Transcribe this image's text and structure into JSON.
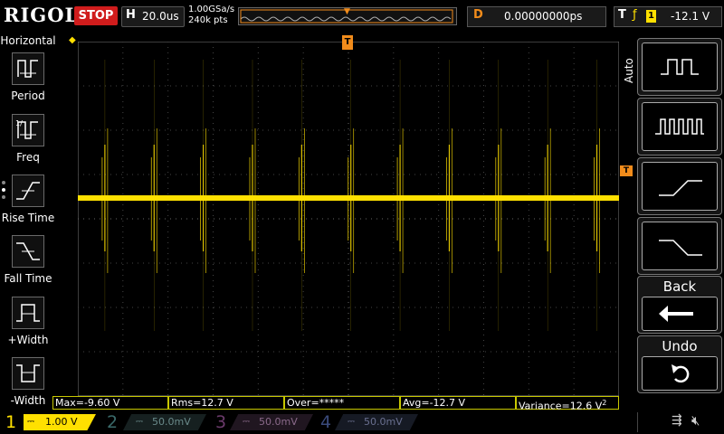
{
  "header": {
    "logo": "RIGOL",
    "run_state": "STOP",
    "timebase_label": "H",
    "timebase_value": "20.0us",
    "sample_rate": "1.00GSa/s",
    "memory_depth": "240k pts",
    "delay_label": "D",
    "delay_value": "0.00000000ps",
    "trigger_label": "T",
    "trigger_edge": "rising-edge-icon",
    "trigger_source": "1",
    "trigger_level": "-12.1 V"
  },
  "left_menu": {
    "title": "Horizontal",
    "items": [
      {
        "label": "Period",
        "icon": "period-icon"
      },
      {
        "label": "Freq",
        "icon": "frequency-icon"
      },
      {
        "label": "Rise Time",
        "icon": "rise-time-icon"
      },
      {
        "label": "Fall Time",
        "icon": "fall-time-icon"
      },
      {
        "label": "+Width",
        "icon": "positive-width-icon"
      },
      {
        "label": "-Width",
        "icon": "negative-width-icon"
      }
    ]
  },
  "right_menu": {
    "mode": "Auto",
    "buttons": [
      {
        "icon": "single-pulse-icon"
      },
      {
        "icon": "pulse-train-icon"
      },
      {
        "icon": "rising-ramp-icon"
      },
      {
        "icon": "falling-ramp-icon"
      }
    ],
    "back_label": "Back",
    "undo_label": "Undo"
  },
  "measurements": {
    "max": "Max=-9.60 V",
    "rms": "Rms=12.7 V",
    "over": "Over=*****",
    "avg": "Avg=-12.7 V",
    "variance": "Variance=12.6 V",
    "variance_sup": "2"
  },
  "channels": [
    {
      "num": "1",
      "scale": "1.00 V",
      "color": "#ffe000"
    },
    {
      "num": "2",
      "scale": "50.0mV",
      "color": "#00c8c8"
    },
    {
      "num": "3",
      "scale": "50.0mV",
      "color": "#d040d0"
    },
    {
      "num": "4",
      "scale": "50.0mV",
      "color": "#3070e0"
    }
  ],
  "waveform": {
    "color": "#ffe000",
    "spike_count": 11
  }
}
